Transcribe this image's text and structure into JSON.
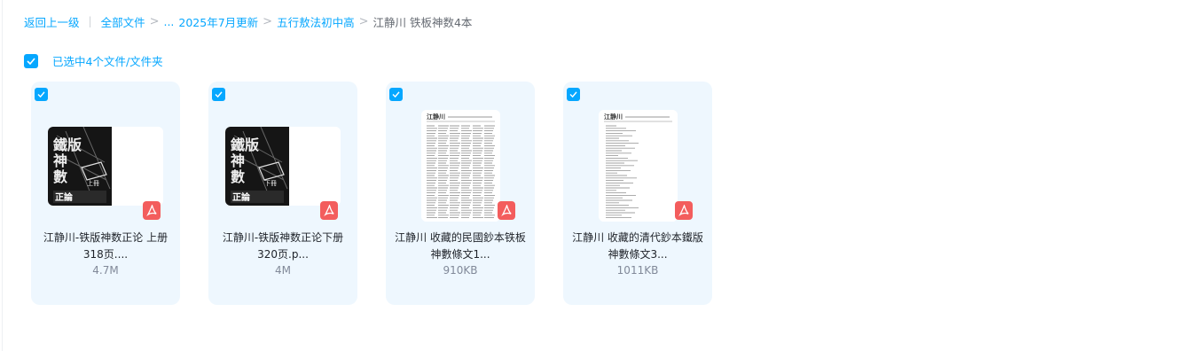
{
  "breadcrumb": {
    "back": "返回上一级",
    "separator_bar": "|",
    "root": "全部文件",
    "ellipsis": "...",
    "chevron": ">",
    "items": [
      "2025年7月更新",
      "五行敖法初中高"
    ],
    "current": "江静川 铁板神数4本"
  },
  "selection": {
    "text": "已选中4个文件/文件夹",
    "checked": true
  },
  "colors": {
    "accent": "#06a7ff",
    "card_bg": "#eef7fe",
    "pdf_badge": "#f35d5d"
  },
  "files": [
    {
      "name": "江静川-铁版神数正论 上册318页....",
      "size": "4.7M",
      "type": "pdf",
      "thumb": "cover",
      "checked": true,
      "cover_title": "鐵版神數",
      "cover_sub": "上冊",
      "cover_bottom": "正論"
    },
    {
      "name": "江静川-铁版神数正论下册320页.p...",
      "size": "4M",
      "type": "pdf",
      "thumb": "cover",
      "checked": true,
      "cover_title": "鐵版神數",
      "cover_sub": "下冊",
      "cover_bottom": "正論"
    },
    {
      "name": "江静川 收藏的民國鈔本铁板神數條文1...",
      "size": "910KB",
      "type": "pdf",
      "thumb": "text-dense",
      "checked": true,
      "doc_heading": "江静川"
    },
    {
      "name": "江静川 收藏的清代鈔本鐵版神數條文3...",
      "size": "1011KB",
      "type": "pdf",
      "thumb": "text-list",
      "checked": true,
      "doc_heading": "江静川"
    }
  ]
}
